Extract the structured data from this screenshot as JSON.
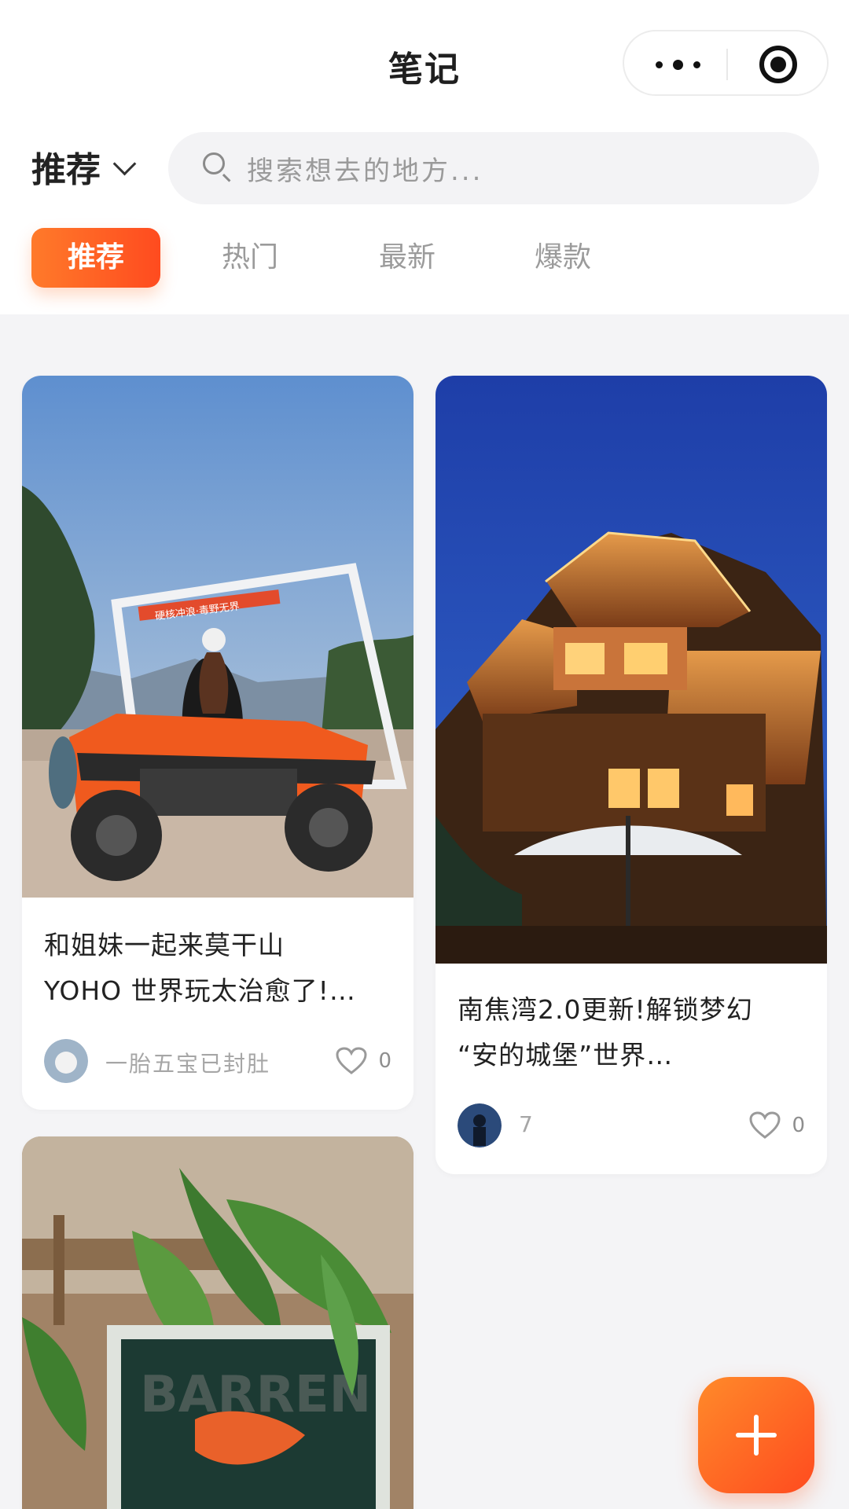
{
  "header": {
    "title": "笔记",
    "channel": "推荐",
    "search_placeholder": "搜索想去的地方..."
  },
  "tabs": [
    {
      "label": "推荐",
      "active": true
    },
    {
      "label": "热门",
      "active": false
    },
    {
      "label": "最新",
      "active": false
    },
    {
      "label": "爆款",
      "active": false
    }
  ],
  "notes": [
    {
      "title_line1": "和姐妹一起来莫干山",
      "title_line2": "YOHO 世界玩太治愈了!…",
      "author": "一胎五宝已封肚",
      "likes": "0",
      "image_text": "硬核冲浪·毒野无界"
    },
    {
      "title_line1": "南焦湾2.0更新!解锁梦幻",
      "title_line2": "“安的城堡”世界…",
      "author": "7",
      "likes": "0"
    },
    {
      "image_text": "BARREN"
    }
  ],
  "colors": {
    "accent": "#ff5a1f",
    "accent_light": "#ff8a2a",
    "background": "#f4f4f6"
  },
  "icons": [
    "more-icon",
    "target-icon",
    "chevron-down-icon",
    "search-icon",
    "heart-icon",
    "plus-icon"
  ]
}
